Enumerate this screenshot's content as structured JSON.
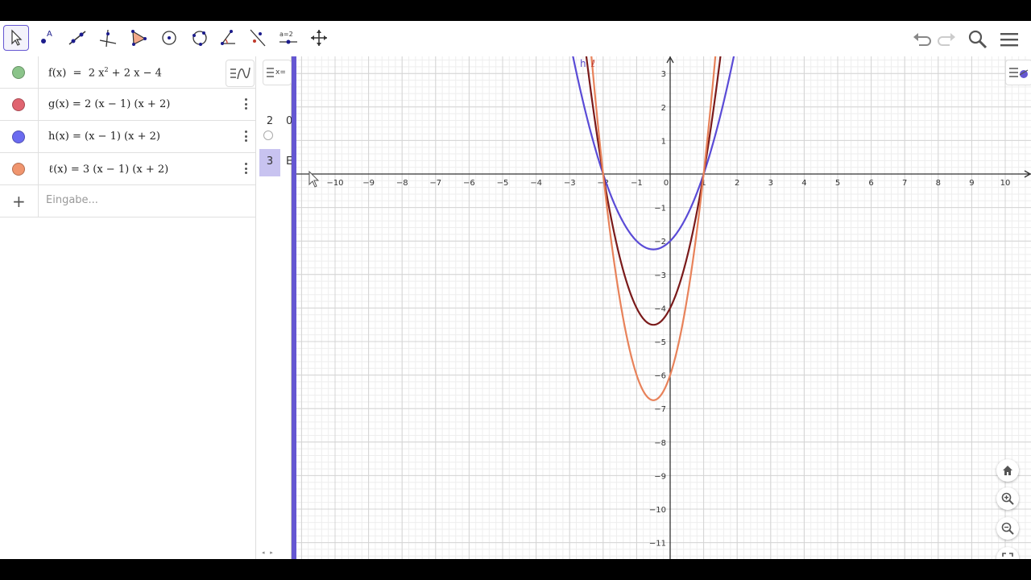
{
  "toolbar": {
    "tools": [
      {
        "name": "move-tool",
        "active": true
      },
      {
        "name": "point-tool"
      },
      {
        "name": "line-tool"
      },
      {
        "name": "perpendicular-line-tool"
      },
      {
        "name": "polygon-tool"
      },
      {
        "name": "circle-center-point-tool"
      },
      {
        "name": "circle-three-points-tool"
      },
      {
        "name": "angle-tool"
      },
      {
        "name": "reflect-tool"
      },
      {
        "name": "slider-tool",
        "label": "a=2"
      },
      {
        "name": "move-graphics-view-tool"
      }
    ],
    "right_icons": [
      "undo-icon",
      "redo-icon",
      "search-icon",
      "menu-icon"
    ]
  },
  "algebra": {
    "rows": [
      {
        "name": "f",
        "color": "#8bc48a",
        "expr_html": "f(x) &nbsp;= &nbsp;2 x<sup style='font-size:8px'>2</sup> + 2 x − 4",
        "expr": "f(x) = 2 x² + 2 x − 4"
      },
      {
        "name": "g",
        "color": "#e06470",
        "expr": "g(x) = 2 (x − 1) (x + 2)"
      },
      {
        "name": "h",
        "color": "#6b6bf0",
        "expr": "h(x) = (x − 1) (x + 2)"
      },
      {
        "name": "l",
        "color": "#f0956e",
        "expr": "ℓ(x) = 3 (x − 1) (x + 2)"
      }
    ],
    "input_placeholder": "Eingabe..."
  },
  "spreadsheet": {
    "toggle_label": "x=",
    "rows": [
      {
        "num": "2",
        "cell": "0"
      },
      {
        "num": "3",
        "cell": "E"
      }
    ]
  },
  "graphics": {
    "x_ticks": [
      -10,
      -9,
      -8,
      -7,
      -6,
      -5,
      -4,
      -3,
      -2,
      -1,
      0,
      1,
      2,
      3,
      4,
      5,
      6,
      7,
      8,
      9,
      10
    ],
    "y_ticks": [
      3,
      2,
      1,
      -1,
      -2,
      -3,
      -4,
      -5,
      -6,
      -7,
      -8,
      -9,
      -10,
      -11
    ],
    "curve_labels": [
      {
        "text": "h",
        "color": "#5a4bc8"
      },
      {
        "text": "ℓ",
        "color": "#c0392b"
      }
    ],
    "curves": [
      {
        "id": "h",
        "color": "#5a4bd6",
        "a": 1
      },
      {
        "id": "f",
        "color": "#7a1a1a",
        "a": 2
      },
      {
        "id": "l",
        "color": "#e8825a",
        "a": 3
      }
    ],
    "buttons": [
      "home-icon",
      "zoom-in-icon",
      "zoom-out-icon",
      "fullscreen-icon"
    ]
  }
}
